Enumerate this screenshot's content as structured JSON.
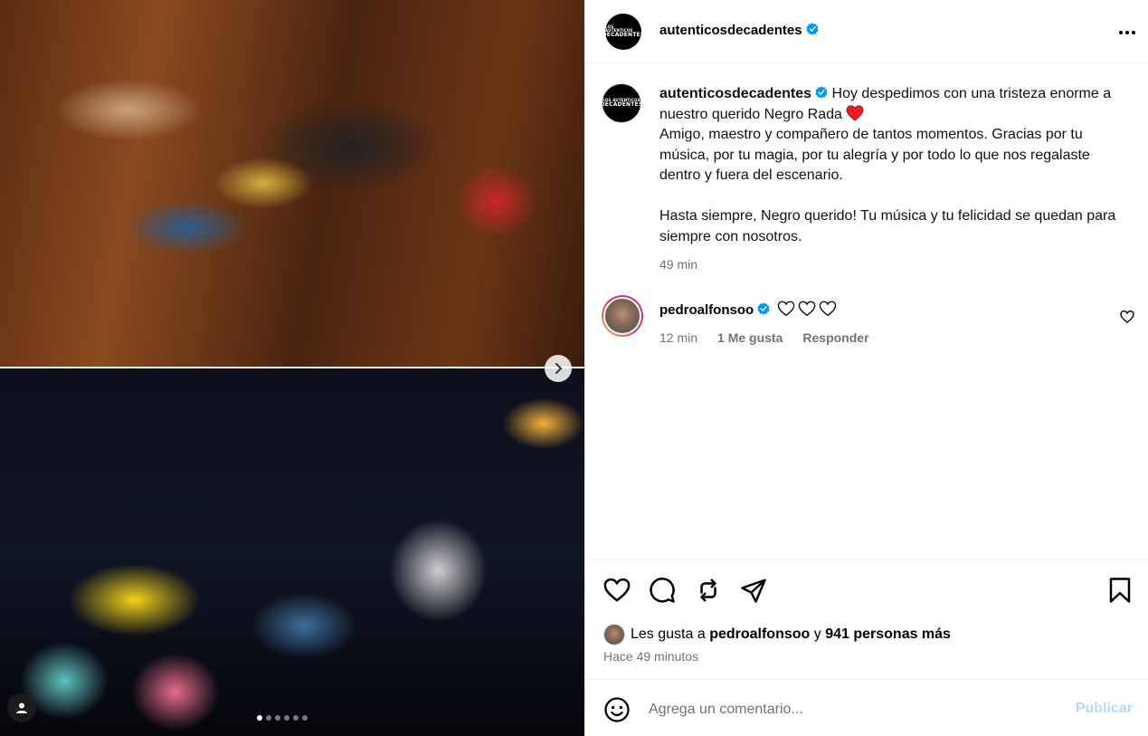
{
  "post": {
    "username": "autenticosdecadentes",
    "avatar_text_line1": "LOS AUTENTICOS",
    "avatar_text_line2": "DECADENTES",
    "more_icon": "more-options-icon"
  },
  "caption": {
    "username": "autenticosdecadentes",
    "line1": "Hoy despedimos con una tristeza enorme a nuestro querido Negro Rada",
    "line2": "Amigo, maestro y compañero de tantos momentos. Gracias por tu música, por tu magia, por tu alegría y por todo lo que nos regalaste dentro y fuera del escenario.",
    "line3": "Hasta siempre, Negro querido! Tu música y tu felicidad se quedan para siempre con nosotros.",
    "time": "49 min"
  },
  "comment": {
    "username": "pedroalfonsoo",
    "time": "12 min",
    "likes": "1 Me gusta",
    "reply": "Responder"
  },
  "likes": {
    "prefix": "Les gusta a",
    "user": "pedroalfonsoo",
    "connector": "y",
    "others": "941 personas más"
  },
  "post_time": "Hace 49 minutos",
  "comment_box": {
    "placeholder": "Agrega un comentario...",
    "publish": "Publicar"
  },
  "carousel": {
    "count": 6,
    "active_index": 0
  },
  "colors": {
    "verified": "#0095f6",
    "publish_disabled": "#b3dbff",
    "muted": "#737373",
    "heart": "#ed1c24"
  }
}
